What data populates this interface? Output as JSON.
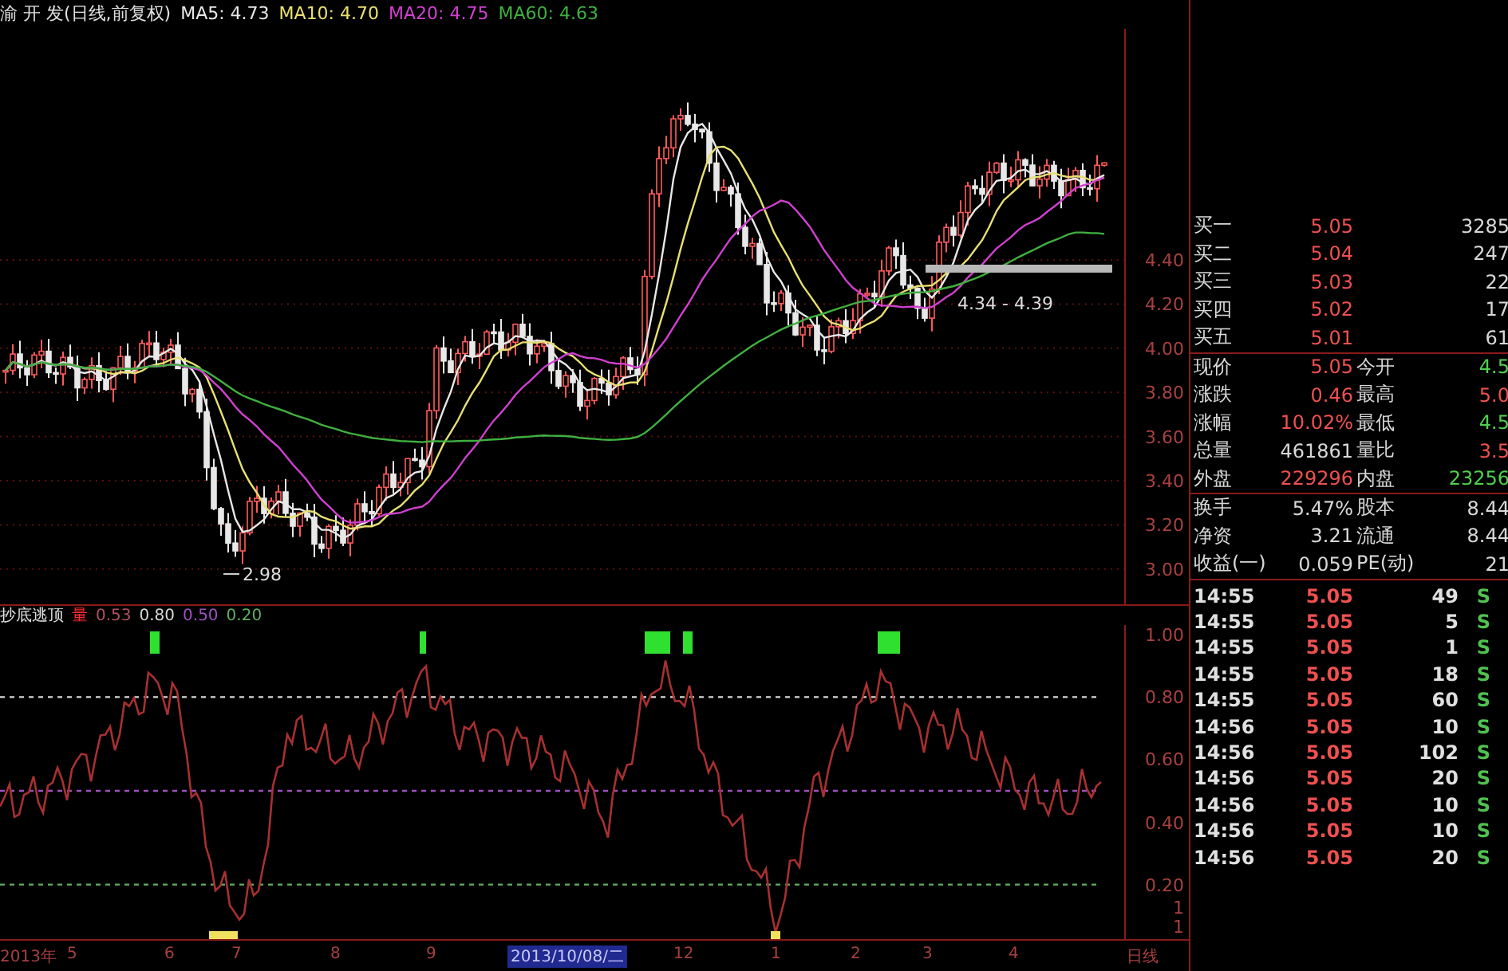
{
  "chart_header": {
    "stock": "渝 开 发(日线,前复权)",
    "ma": [
      {
        "label": "MA5: 4.73",
        "color": "#e8e8e8"
      },
      {
        "label": "MA10: 4.70",
        "color": "#e8e070"
      },
      {
        "label": "MA20: 4.75",
        "color": "#d040d0"
      },
      {
        "label": "MA60: 4.63",
        "color": "#40b040"
      }
    ]
  },
  "price_axis": [
    "4.40",
    "4.20",
    "4.00",
    "3.80",
    "3.60",
    "3.40",
    "3.20",
    "3.00"
  ],
  "low_label": "2.98",
  "range_label": "4.34 - 4.39",
  "indicator": {
    "title": "抄底逃顶",
    "volume_label": "量",
    "values": [
      {
        "label": "0.53",
        "color": "#b05060"
      },
      {
        "label": "0.80",
        "color": "#d8d8d8"
      },
      {
        "label": "0.50",
        "color": "#a050c0"
      },
      {
        "label": "0.20",
        "color": "#60b060"
      }
    ],
    "axis": [
      "1.00",
      "0.80",
      "0.60",
      "0.40",
      "0.20",
      "1",
      "1"
    ]
  },
  "x_axis": [
    {
      "label": "2013年",
      "selected": false
    },
    {
      "label": "5",
      "selected": false
    },
    {
      "label": "6",
      "selected": false
    },
    {
      "label": "7",
      "selected": false
    },
    {
      "label": "8",
      "selected": false
    },
    {
      "label": "9",
      "selected": false
    },
    {
      "label": "2013/10/08/二",
      "selected": true
    },
    {
      "label": "12",
      "selected": false
    },
    {
      "label": "1",
      "selected": false
    },
    {
      "label": "2",
      "selected": false
    },
    {
      "label": "3",
      "selected": false
    },
    {
      "label": "4",
      "selected": false
    },
    {
      "label": "日线",
      "selected": false
    }
  ],
  "bids": [
    {
      "label": "买一",
      "price": "5.05",
      "volume": "3285"
    },
    {
      "label": "买二",
      "price": "5.04",
      "volume": "247"
    },
    {
      "label": "买三",
      "price": "5.03",
      "volume": "22"
    },
    {
      "label": "买四",
      "price": "5.02",
      "volume": "17"
    },
    {
      "label": "买五",
      "price": "5.01",
      "volume": "61"
    }
  ],
  "stats": [
    {
      "left": {
        "label": "现价",
        "value": "5.05",
        "color": "#f05050"
      },
      "right": {
        "label": "今开",
        "value": "4.5",
        "color": "#50d050"
      }
    },
    {
      "left": {
        "label": "涨跌",
        "value": "0.46",
        "color": "#f05050"
      },
      "right": {
        "label": "最高",
        "value": "5.0",
        "color": "#f05050"
      }
    },
    {
      "left": {
        "label": "涨幅",
        "value": "10.02%",
        "color": "#f05050"
      },
      "right": {
        "label": "最低",
        "value": "4.5",
        "color": "#50d050"
      }
    },
    {
      "left": {
        "label": "总量",
        "value": "461861",
        "color": "#d8d8d8"
      },
      "right": {
        "label": "量比",
        "value": "3.5",
        "color": "#f05050"
      }
    },
    {
      "left": {
        "label": "外盘",
        "value": "229296",
        "color": "#f05050"
      },
      "right": {
        "label": "内盘",
        "value": "23256",
        "color": "#50d050"
      }
    },
    {
      "left": {
        "label": "换手",
        "value": "5.47%",
        "color": "#d8d8d8"
      },
      "right": {
        "label": "股本",
        "value": "8.44",
        "color": "#d8d8d8"
      }
    },
    {
      "left": {
        "label": "净资",
        "value": "3.21",
        "color": "#d8d8d8"
      },
      "right": {
        "label": "流通",
        "value": "8.44",
        "color": "#d8d8d8"
      }
    },
    {
      "left": {
        "label": "收益(一)",
        "value": "0.059",
        "color": "#d8d8d8"
      },
      "right": {
        "label": "PE(动)",
        "value": "21",
        "color": "#d8d8d8"
      }
    }
  ],
  "trades": [
    {
      "time": "14:55",
      "price": "5.05",
      "volume": "49",
      "side": "S"
    },
    {
      "time": "14:55",
      "price": "5.05",
      "volume": "5",
      "side": "S"
    },
    {
      "time": "14:55",
      "price": "5.05",
      "volume": "1",
      "side": "S"
    },
    {
      "time": "14:55",
      "price": "5.05",
      "volume": "18",
      "side": "S"
    },
    {
      "time": "14:55",
      "price": "5.05",
      "volume": "60",
      "side": "S"
    },
    {
      "time": "14:56",
      "price": "5.05",
      "volume": "10",
      "side": "S"
    },
    {
      "time": "14:56",
      "price": "5.05",
      "volume": "102",
      "side": "S"
    },
    {
      "time": "14:56",
      "price": "5.05",
      "volume": "20",
      "side": "S"
    },
    {
      "time": "14:56",
      "price": "5.05",
      "volume": "10",
      "side": "S"
    },
    {
      "time": "14:56",
      "price": "5.05",
      "volume": "10",
      "side": "S"
    },
    {
      "time": "14:56",
      "price": "5.05",
      "volume": "20",
      "side": "S"
    }
  ]
}
